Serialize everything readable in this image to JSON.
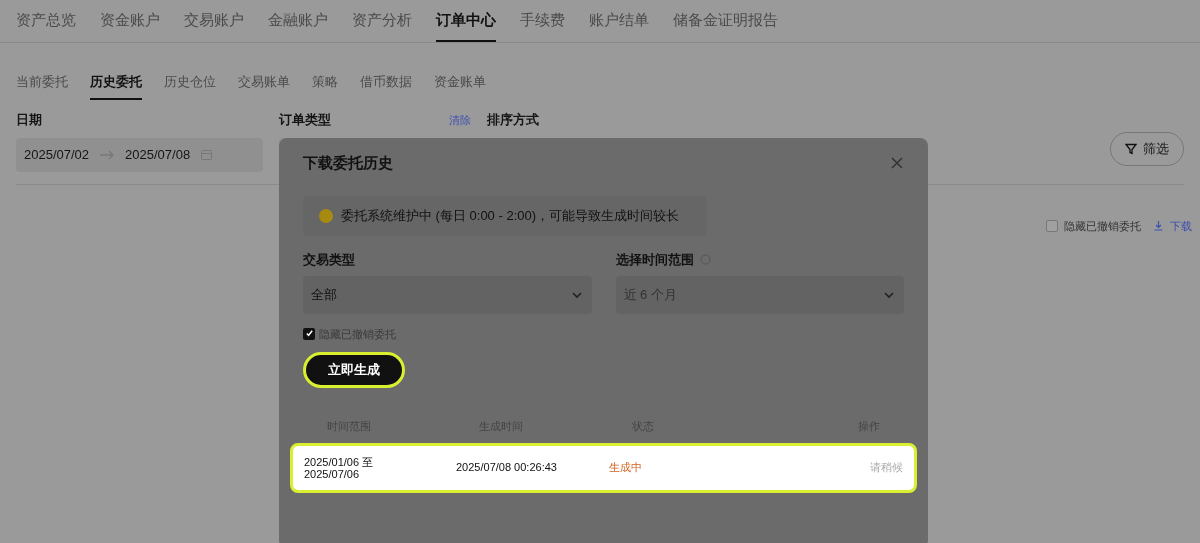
{
  "main_tabs": [
    {
      "label": "资产总览",
      "selected": false
    },
    {
      "label": "资金账户",
      "selected": false
    },
    {
      "label": "交易账户",
      "selected": false
    },
    {
      "label": "金融账户",
      "selected": false
    },
    {
      "label": "资产分析",
      "selected": false
    },
    {
      "label": "订单中心",
      "selected": true
    },
    {
      "label": "手续费",
      "selected": false
    },
    {
      "label": "账户结单",
      "selected": false
    },
    {
      "label": "储备金证明报告",
      "selected": false
    }
  ],
  "sub_tabs": [
    {
      "label": "当前委托",
      "selected": false
    },
    {
      "label": "历史委托",
      "selected": true
    },
    {
      "label": "历史仓位",
      "selected": false
    },
    {
      "label": "交易账单",
      "selected": false
    },
    {
      "label": "策略",
      "selected": false
    },
    {
      "label": "借币数据",
      "selected": false
    },
    {
      "label": "资金账单",
      "selected": false
    }
  ],
  "filters": {
    "date_label": "日期",
    "date_from": "2025/07/02",
    "date_to": "2025/07/08",
    "order_type_label": "订单类型",
    "clear": "清除",
    "sort_label": "排序方式",
    "filter_button": "筛选"
  },
  "toolbar": {
    "hide_cancelled": {
      "label": "隐藏已撤销委托",
      "checked": false
    },
    "download": "下载"
  },
  "dialog": {
    "title": "下载委托历史",
    "notice": "委托系统维护中 (每日 0:00 - 2:00)，可能导致生成时间较长",
    "trade_type": {
      "label": "交易类型",
      "value": "全部"
    },
    "time_range": {
      "label": "选择时间范围",
      "value": "近 6 个月"
    },
    "hide_cancelled": {
      "label": "隐藏已撤销委托",
      "checked": true
    },
    "generate_button": "立即生成",
    "table": {
      "columns": [
        "时间范围",
        "生成时间",
        "状态",
        "操作"
      ],
      "rows": [
        {
          "range_from": "2025/01/06 至",
          "range_to": "2025/07/06",
          "time": "2025/07/08 00:26:43",
          "status": "生成中",
          "action": "请稍候"
        }
      ]
    }
  }
}
